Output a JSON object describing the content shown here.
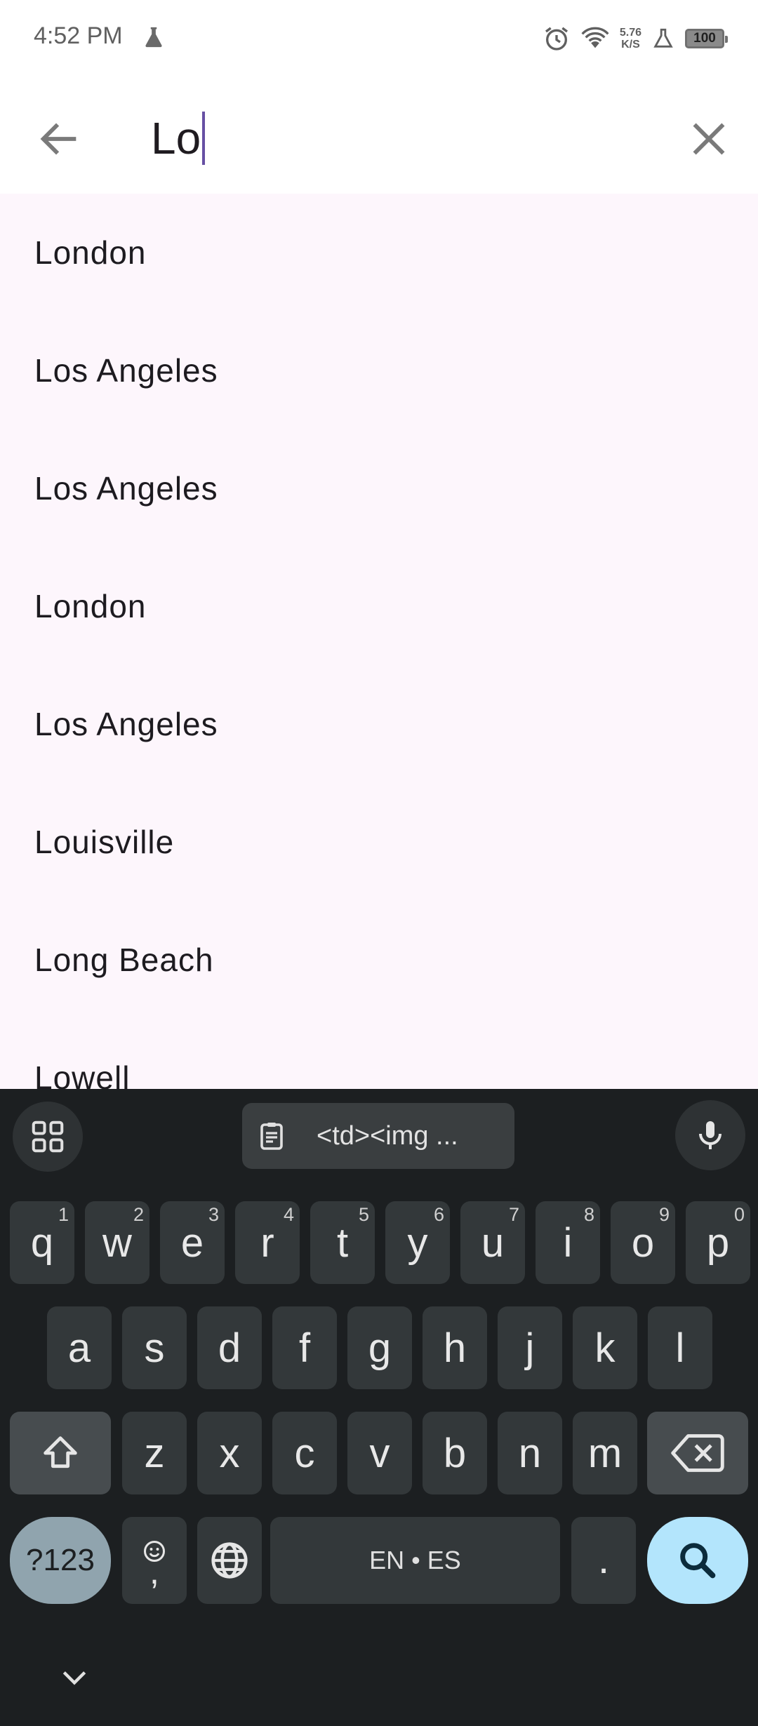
{
  "status_bar": {
    "time": "4:52 PM",
    "net_speed_value": "5.76",
    "net_speed_unit": "K/S",
    "battery": "100"
  },
  "search": {
    "query": "Lo"
  },
  "results": [
    "London",
    "Los Angeles",
    "Los Angeles",
    "London",
    "Los Angeles",
    "Louisville",
    "Long Beach",
    "Lowell"
  ],
  "keyboard": {
    "clipboard_text": "<td><img ...",
    "row1": [
      {
        "key": "q",
        "hint": "1"
      },
      {
        "key": "w",
        "hint": "2"
      },
      {
        "key": "e",
        "hint": "3"
      },
      {
        "key": "r",
        "hint": "4"
      },
      {
        "key": "t",
        "hint": "5"
      },
      {
        "key": "y",
        "hint": "6"
      },
      {
        "key": "u",
        "hint": "7"
      },
      {
        "key": "i",
        "hint": "8"
      },
      {
        "key": "o",
        "hint": "9"
      },
      {
        "key": "p",
        "hint": "0"
      }
    ],
    "row2": [
      "a",
      "s",
      "d",
      "f",
      "g",
      "h",
      "j",
      "k",
      "l"
    ],
    "row3": [
      "z",
      "x",
      "c",
      "v",
      "b",
      "n",
      "m"
    ],
    "symbols_label": "?123",
    "comma_label": ",",
    "space_label": "EN • ES",
    "period_label": "."
  },
  "colors": {
    "accent_caret": "#6750a4",
    "keyboard_bg": "#1c1f21",
    "search_key": "#b3e5fc",
    "list_bg": "#fdf6fc"
  },
  "icons": [
    "flask-icon",
    "alarm-icon",
    "wifi-icon",
    "lab-icon",
    "battery-icon",
    "back-arrow-icon",
    "close-icon",
    "apps-grid-icon",
    "clipboard-icon",
    "mic-icon",
    "shift-icon",
    "backspace-icon",
    "emoji-icon",
    "globe-icon",
    "search-icon",
    "chevron-down-icon"
  ]
}
